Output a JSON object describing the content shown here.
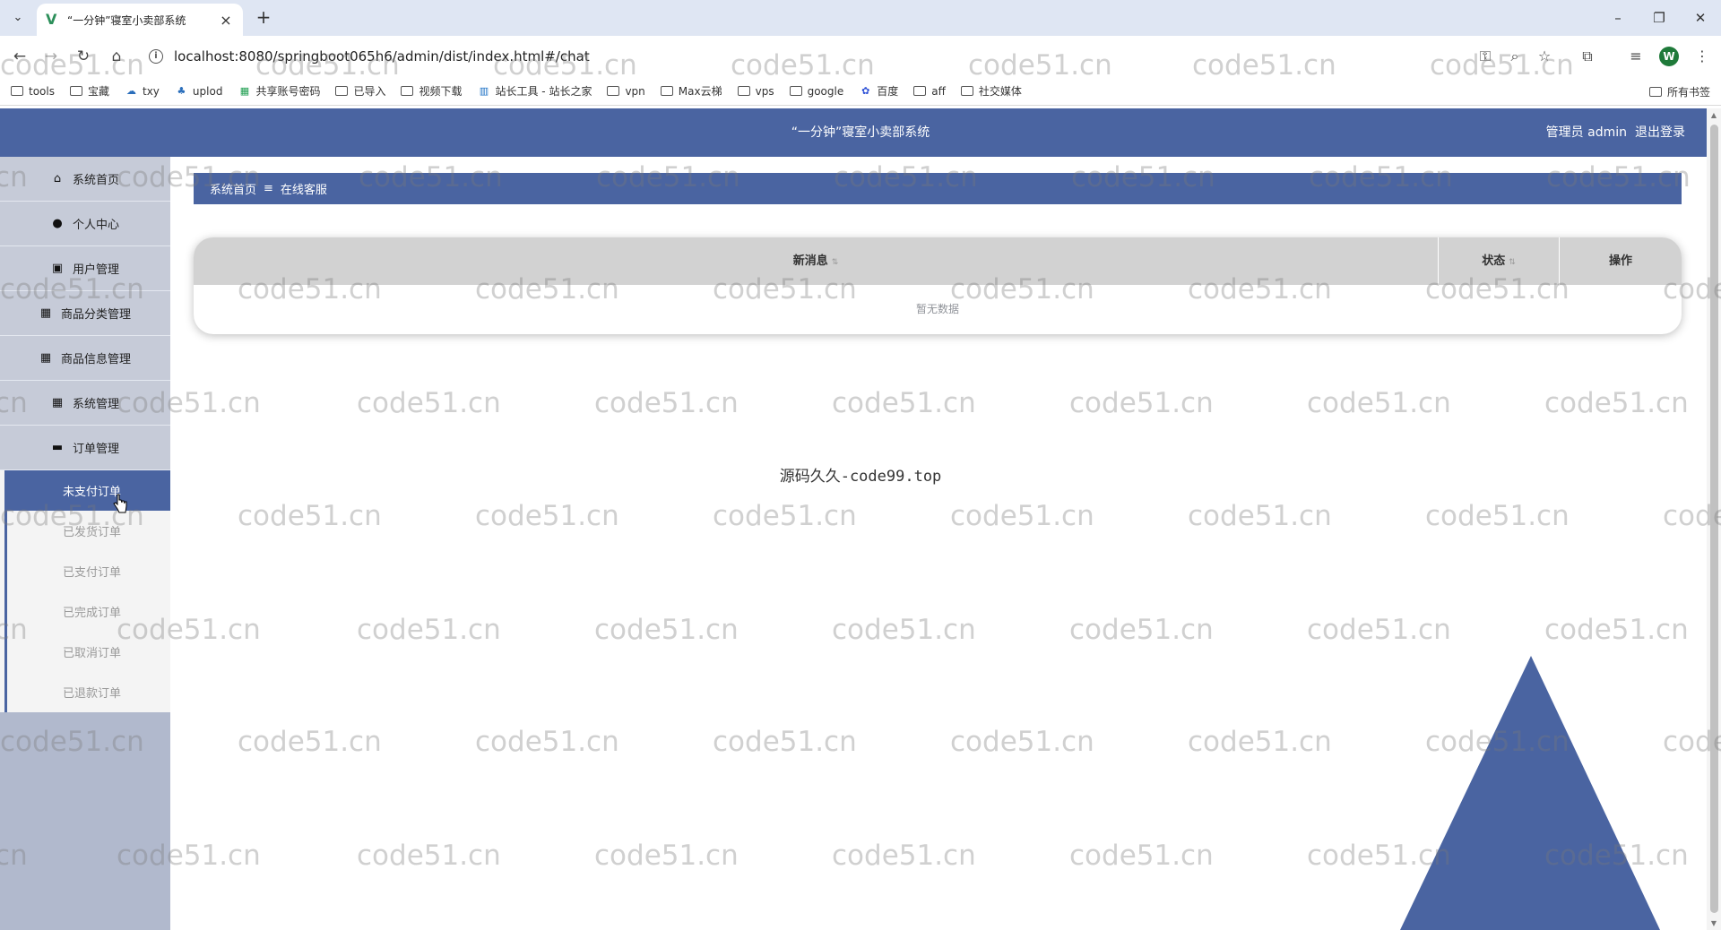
{
  "browser": {
    "tab_title": "“一分钟”寝室小卖部系统",
    "url": "localhost:8080/springboot065h6/admin/dist/index.html#/chat",
    "profile_initial": "W",
    "bookmarks": [
      "tools",
      "宝藏",
      "txy",
      "uplod",
      "共享账号密码",
      "已导入",
      "视频下载",
      "站长工具 - 站长之家",
      "vpn",
      "Max云梯",
      "vps",
      "google",
      "百度",
      "aff",
      "社交媒体"
    ],
    "all_bookmarks": "所有书签"
  },
  "header": {
    "title": "“一分钟”寝室小卖部系统",
    "user_label": "管理员 admin",
    "logout": "退出登录",
    "color": "#4a64a1"
  },
  "sidebar": {
    "items": [
      {
        "label": "系统首页",
        "icon": "home-icon"
      },
      {
        "label": "个人中心",
        "icon": "user-icon"
      },
      {
        "label": "用户管理",
        "icon": "clipboard-icon"
      },
      {
        "label": "商品分类管理",
        "icon": "grid-icon"
      },
      {
        "label": "商品信息管理",
        "icon": "grid-icon"
      },
      {
        "label": "系统管理",
        "icon": "grid-icon"
      },
      {
        "label": "订单管理",
        "icon": "briefcase-icon"
      }
    ],
    "submenu": [
      "未支付订单",
      "已发货订单",
      "已支付订单",
      "已完成订单",
      "已取消订单",
      "已退款订单"
    ],
    "active_submenu": "未支付订单"
  },
  "breadcrumb": {
    "home": "系统首页",
    "separator": "≡",
    "current": "在线客服"
  },
  "table": {
    "columns": [
      "新消息",
      "状态",
      "操作"
    ],
    "empty_text": "暂无数据"
  },
  "footer_text": "源码久久-code99.top",
  "watermark": "code51.cn"
}
